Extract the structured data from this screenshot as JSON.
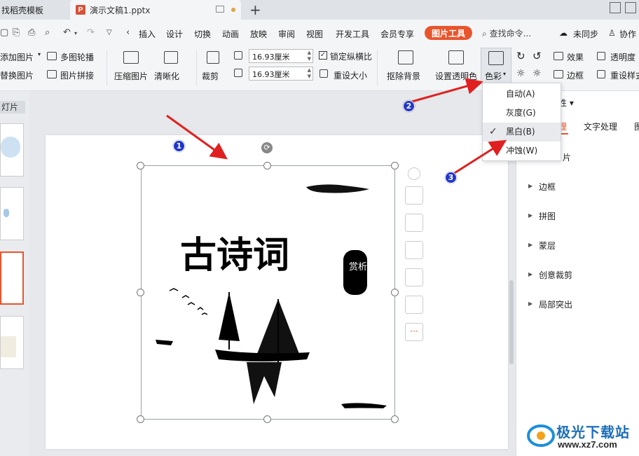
{
  "titlebar": {
    "tab1": "找稻壳模板",
    "tab2": "演示文稿1.pptx",
    "pptx_logo": "P"
  },
  "menu": {
    "items": [
      "插入",
      "设计",
      "切换",
      "动画",
      "放映",
      "审阅",
      "视图",
      "开发工具",
      "会员专享"
    ],
    "active_tool": "图片工具",
    "search": "查找命令...",
    "sync": "未同步",
    "collab": "协作"
  },
  "ribbon": {
    "add_picture": "添加图片",
    "replace_picture": "替换图片",
    "multi_carousel": "多图轮播",
    "picture_splice": "图片拼接",
    "compress": "压缩图片",
    "sharpen": "清晰化",
    "crop": "裁剪",
    "width": "16.93厘米",
    "height": "16.93厘米",
    "lock_ratio": "锁定纵横比",
    "reset_size": "重设大小",
    "remove_bg": "抠除背景",
    "set_transparent": "设置透明色",
    "color": "色彩",
    "effects": "效果",
    "transparency": "透明度",
    "border": "边框",
    "reset_style": "重设样式"
  },
  "left": {
    "slides_tab": "灯片"
  },
  "color_menu": {
    "items": [
      "自动(A)",
      "灰度(G)",
      "黑白(B)",
      "冲蚀(W)"
    ],
    "checked": "黑白(B)"
  },
  "right_panel": {
    "properties": "性 ▾",
    "tabs": [
      "理",
      "文字处理",
      "图"
    ],
    "sections": [
      "片",
      "边框",
      "拼图",
      "蒙层",
      "创意裁剪",
      "局部突出"
    ]
  },
  "picture": {
    "title": "古诗词",
    "seal": "赏析"
  },
  "annotations": {
    "badge1": "1",
    "badge2": "2",
    "badge3": "3"
  },
  "watermark": {
    "name": "极光下载站",
    "url": "www.xz7.com"
  },
  "colors": {
    "accent": "#e8552d",
    "badge": "#2136c9",
    "arrow": "#e02020"
  }
}
